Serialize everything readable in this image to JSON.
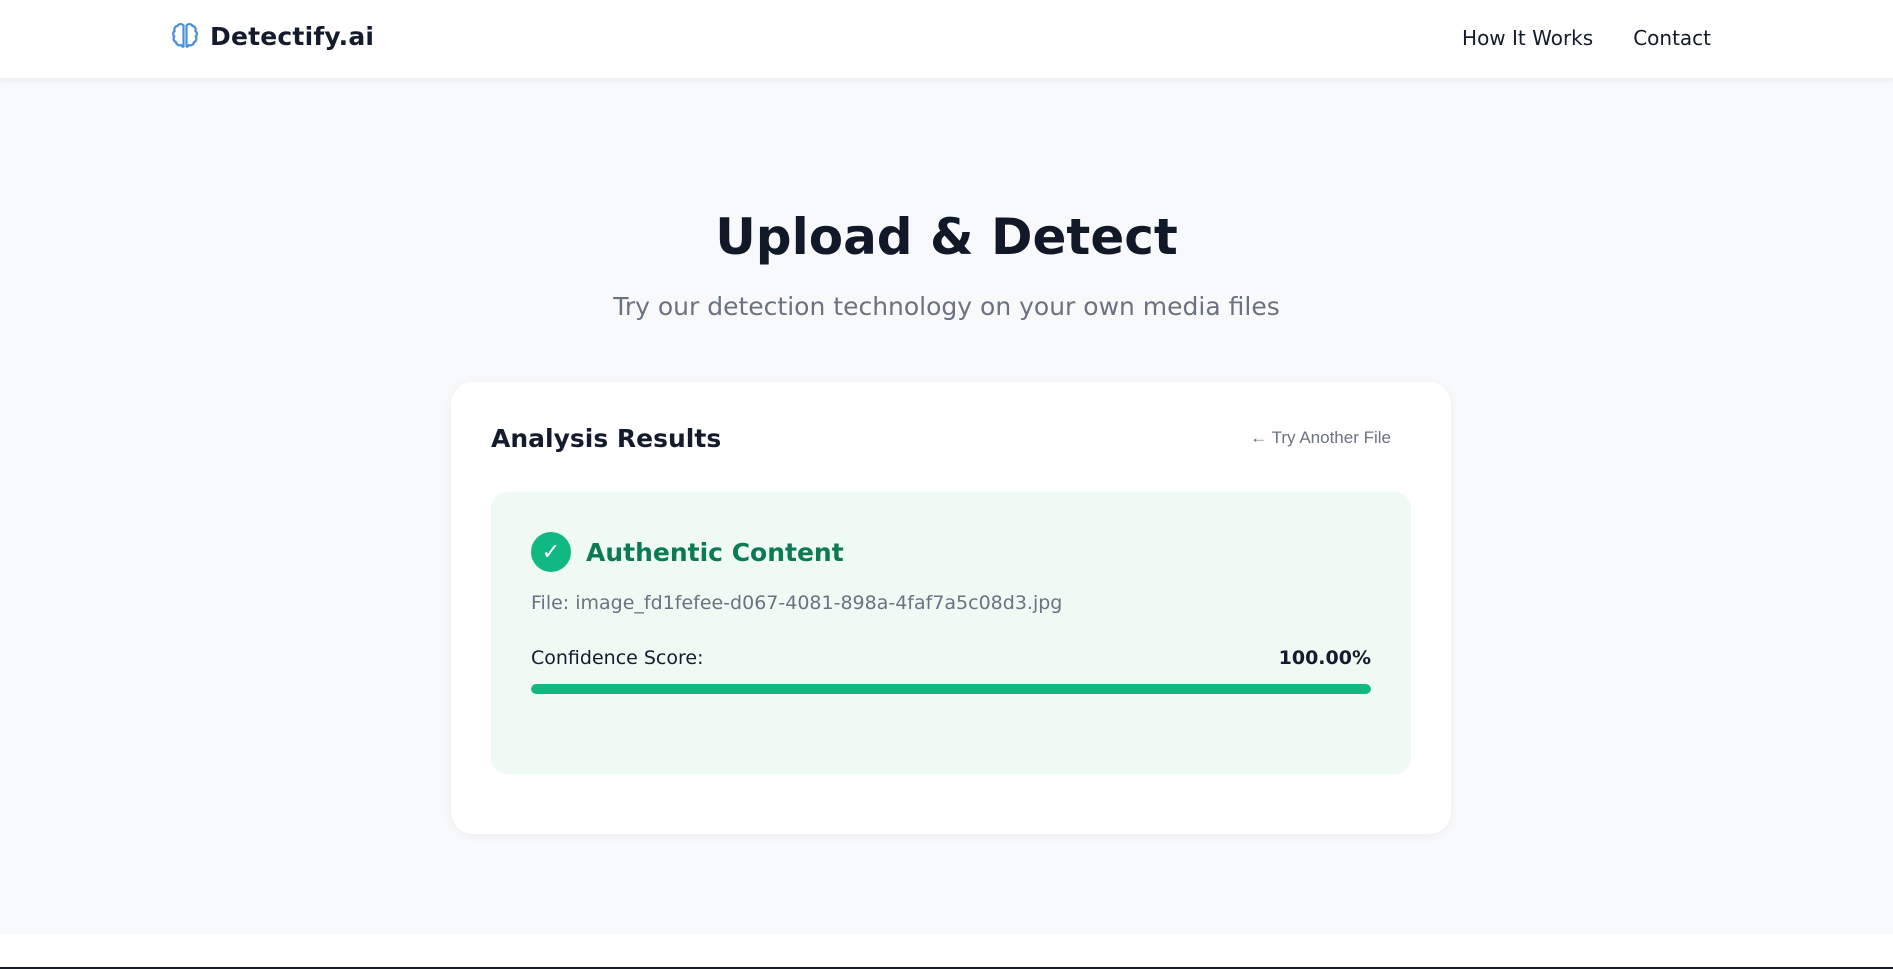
{
  "header": {
    "logo_text": "Detectify.ai",
    "logo_icon": "brain-icon",
    "nav": [
      {
        "label": "How It Works"
      },
      {
        "label": "Contact"
      }
    ]
  },
  "hero": {
    "title": "Upload & Detect",
    "subtitle": "Try our detection technology on your own media files"
  },
  "results": {
    "title": "Analysis Results",
    "back_link": "← Try Another File",
    "verdict": {
      "icon": "check-icon",
      "glyph": "✓",
      "label": "Authentic Content"
    },
    "file_line": "File: image_fd1fefee-d067-4081-898a-4faf7a5c08d3.jpg",
    "confidence_label": "Confidence Score:",
    "confidence_value": "100.00%",
    "confidence_fraction": 1.0
  },
  "colors": {
    "accent": "#10b981",
    "verdict_text": "#0c7a52",
    "panel_bg": "#effaf5",
    "logo_icon": "#4a90d9"
  }
}
